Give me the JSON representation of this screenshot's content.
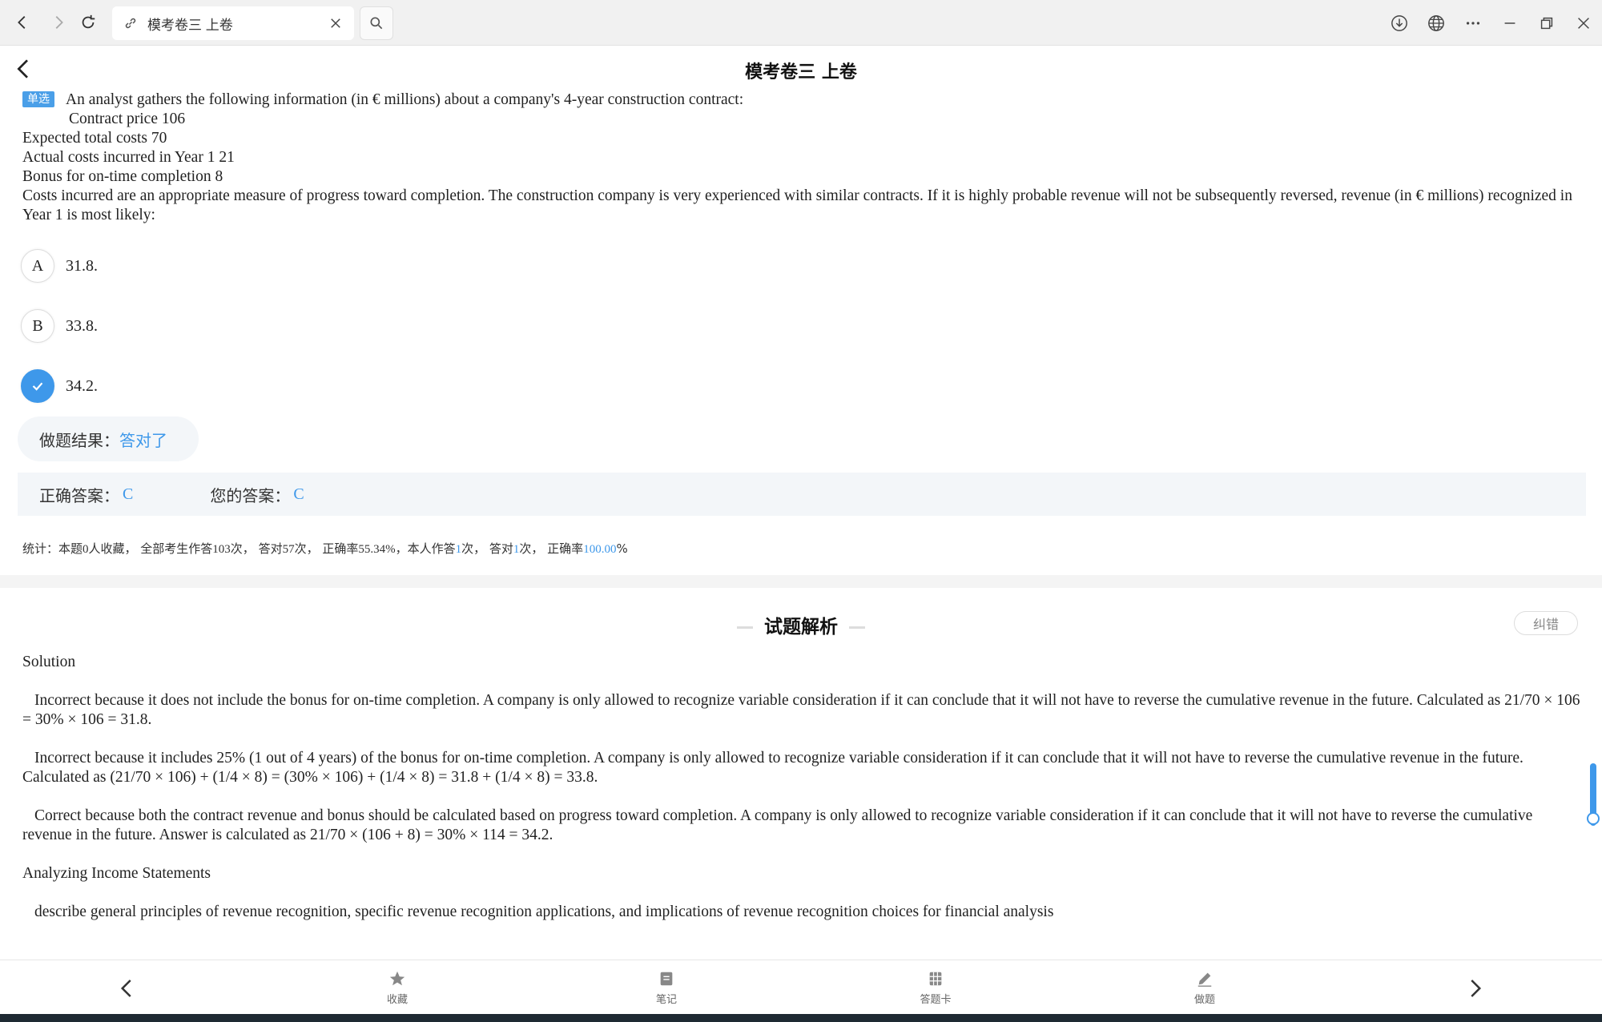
{
  "browser": {
    "tab_title": "模考卷三 上卷",
    "icons": [
      "back-arrow-icon",
      "forward-arrow-icon",
      "reload-icon",
      "link-icon",
      "close-icon",
      "search-icon",
      "download-icon",
      "globe-icon",
      "more-icon",
      "minimize-icon",
      "restore-icon",
      "window-close-icon"
    ]
  },
  "header": {
    "title": "模考卷三 上卷"
  },
  "question": {
    "tag": "单选",
    "line1": "An analyst gathers the following information (in € millions) about a company's 4-year construction contract:",
    "line2": "Contract price  106",
    "line3": "Expected total costs  70",
    "line4": "Actual costs incurred in Year 1  21",
    "line5": "Bonus for on-time completion  8",
    "line6": "Costs incurred are an appropriate measure of progress toward completion. The construction company is very experienced with similar contracts. If it is highly probable revenue will not be subsequently reversed, revenue (in € millions) recognized in Year 1 is most likely:"
  },
  "options": [
    {
      "letter": "A",
      "text": "31.8."
    },
    {
      "letter": "B",
      "text": "33.8."
    },
    {
      "letter": "",
      "text": "34.2."
    }
  ],
  "result": {
    "label": "做题结果：",
    "value": "答对了"
  },
  "answers": {
    "correct_label": "正确答案：",
    "correct_value": "C",
    "yours_label": "您的答案：",
    "yours_value": "C"
  },
  "stats": {
    "prefix": "统计：本题",
    "fav_count": "0",
    "fav_suffix": "人收藏，  全部考生作答",
    "total_answers": "103",
    "p2": "次，  答对",
    "total_correct": "57",
    "p3": "次，  正确率",
    "total_rate": "55.34%",
    "p4": "，本人作答",
    "my_answers": "1",
    "p5": "次，  答对",
    "my_correct": "1",
    "p6": "次，  正确率",
    "my_rate": "100.00",
    "p7": "%"
  },
  "analysis": {
    "title": "试题解析",
    "report_label": "纠错",
    "solution_heading": "Solution",
    "para_a": "Incorrect because it does not include the bonus for on-time completion. A company is only allowed to recognize variable consideration if it can conclude that it will not have to reverse the cumulative revenue in the future. Calculated as 21/70 × 106 = 30% × 106 = 31.8.",
    "para_b": "Incorrect because it includes 25% (1 out of 4 years) of the bonus for on-time completion. A company is only allowed to recognize variable consideration if it can conclude that it will not have to reverse the cumulative revenue in the future. Calculated as (21/70 × 106) + (1/4 × 8) = (30% × 106) + (1/4 × 8) = 31.8 + (1/4 × 8) = 33.8.",
    "para_c": "Correct because both the contract revenue and bonus should be calculated based on progress toward completion. A company is only allowed to recognize variable consideration if it can conclude that it will not have to reverse the cumulative revenue in the future. Answer is calculated as 21/70 × (106 + 8) = 30% × 114 = 34.2.",
    "topic_heading": "Analyzing Income Statements",
    "topic_text": "describe general principles of revenue recognition, specific revenue recognition applications, and implications of revenue recognition choices for financial analysis"
  },
  "toolbar": {
    "favorite": "收藏",
    "notes": "笔记",
    "answer_card": "答题卡",
    "practice": "做题"
  },
  "colors": {
    "accent": "#3e98ea",
    "panel": "#f3f6f9"
  }
}
